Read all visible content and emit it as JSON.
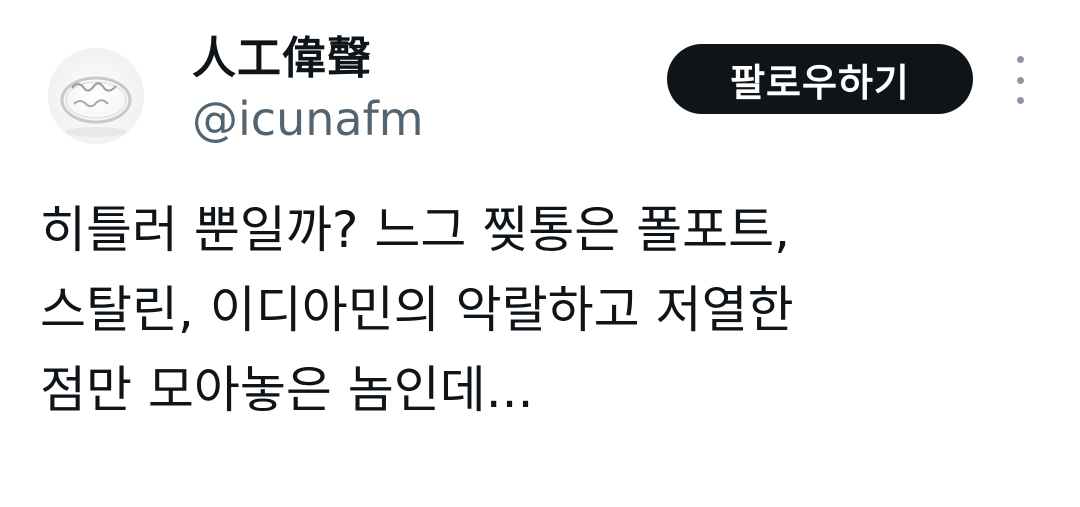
{
  "author": {
    "display_name": "人工偉聲",
    "handle": "@icunafm",
    "avatar_icon": "ring-avatar-icon"
  },
  "actions": {
    "follow_label": "팔로우하기",
    "more_icon": "more-vertical-icon"
  },
  "tweet": {
    "lines": [
      "히틀러 뿐일까? 느그 찢통은 폴포트,",
      "스탈린, 이디아민의 악랄하고 저열한",
      "점만 모아놓은 놈인데..."
    ]
  },
  "colors": {
    "text_primary": "#0f1419",
    "text_secondary": "#536471",
    "button_bg": "#0f1419",
    "button_text": "#ffffff"
  }
}
